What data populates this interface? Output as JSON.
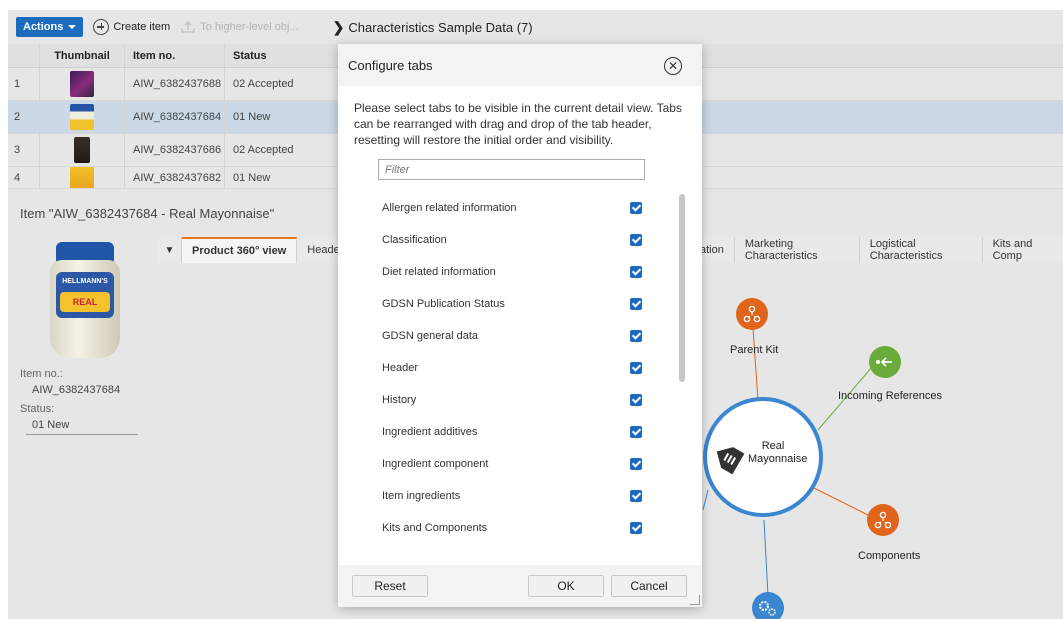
{
  "toolbar": {
    "actions_label": "Actions",
    "create_label": "Create item",
    "higher_level_label": "To higher-level obj...",
    "breadcrumb": "Characteristics Sample Data (7)"
  },
  "grid": {
    "headers": [
      "Thumbnail",
      "Item no.",
      "Status"
    ],
    "rows": [
      {
        "num": "1",
        "item": "AIW_6382437688",
        "status": "02 Accepted"
      },
      {
        "num": "2",
        "item": "AIW_6382437684",
        "status": "01 New"
      },
      {
        "num": "3",
        "item": "AIW_6382437686",
        "status": "02 Accepted"
      },
      {
        "num": "4",
        "item": "AIW_6382437682",
        "status": "01 New"
      }
    ]
  },
  "detail": {
    "title": "Item \"AIW_6382437684 - Real Mayonnaise\"",
    "item_no_label": "Item no.:",
    "item_no_value": "AIW_6382437684",
    "status_label": "Status:",
    "status_value": "01 New",
    "jar_brand": "HELLMANN'S",
    "jar_variant": "REAL"
  },
  "tabs": {
    "active": "Product 360° view",
    "header": "Header",
    "right": [
      "ation",
      "Marketing Characteristics",
      "Logistical Characteristics",
      "Kits and Comp"
    ]
  },
  "graph": {
    "center": "Real\nMayonnaise",
    "center_line1": "Real",
    "center_line2": "Mayonnaise",
    "parent_kit": "Parent Kit",
    "incoming": "Incoming References",
    "components": "Components",
    "colors": {
      "orange": "#e0641a",
      "green": "#6bab3c",
      "blue": "#3a86d1"
    }
  },
  "modal": {
    "title": "Configure tabs",
    "description": "Please select tabs to be visible in the current detail view. Tabs can be rearranged with drag and drop of the tab header, resetting will restore the initial order and visibility.",
    "filter_placeholder": "Filter",
    "items": [
      "Allergen related information",
      "Classification",
      "Diet related information",
      "GDSN Publication Status",
      "GDSN general data",
      "Header",
      "History",
      "Ingredient additives",
      "Ingredient component",
      "Item ingredients",
      "Kits and Components"
    ],
    "reset_label": "Reset",
    "ok_label": "OK",
    "cancel_label": "Cancel"
  }
}
